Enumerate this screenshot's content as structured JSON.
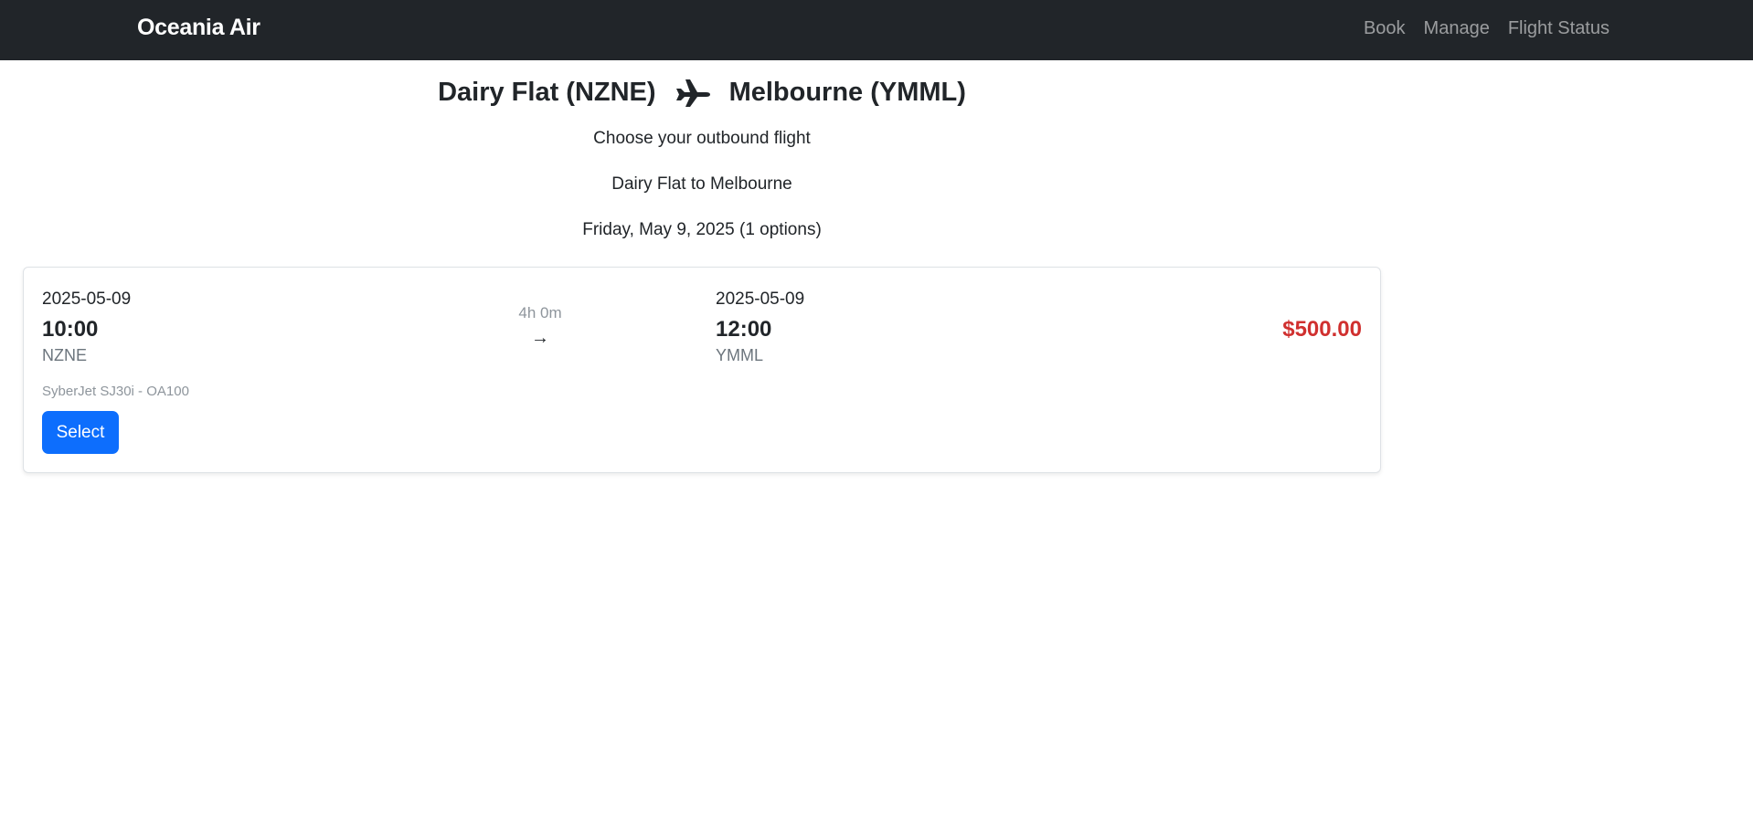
{
  "navbar": {
    "brand": "Oceania Air",
    "links": [
      "Book",
      "Manage",
      "Flight Status"
    ]
  },
  "route": {
    "origin": "Dairy Flat (NZNE)",
    "destination": "Melbourne (YMML)",
    "icon": "airplane-icon"
  },
  "subtitle": "Choose your outbound flight",
  "route_summary": "Dairy Flat to Melbourne",
  "date_summary": "Friday, May 9, 2025 (1 options)",
  "flights": [
    {
      "departure_date": "2025-05-09",
      "departure_time": "10:00",
      "departure_code": "NZNE",
      "duration": "4h 0m",
      "arrow": "→",
      "arrival_date": "2025-05-09",
      "arrival_time": "12:00",
      "arrival_code": "YMML",
      "aircraft": "SyberJet SJ30i - OA100",
      "price": "$500.00",
      "select_label": "Select"
    }
  ],
  "colors": {
    "navbar_bg": "#212529",
    "primary": "#0d6efd",
    "price": "#d0302f"
  }
}
